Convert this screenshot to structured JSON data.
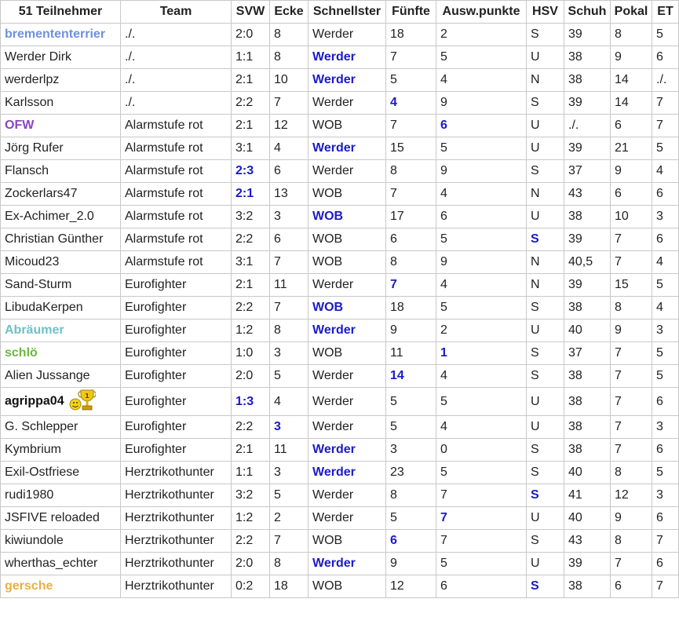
{
  "header": {
    "cells": [
      "51 Teilnehmer",
      "Team",
      "SVW",
      "Ecke",
      "Schnellster",
      "Fünfte",
      "Ausw.punkte",
      "HSV",
      "Schuh",
      "Pokal",
      "ET"
    ]
  },
  "rows": [
    {
      "c": [
        "bremententerrier",
        "./.",
        "2:0",
        "8",
        "Werder",
        "18",
        "2",
        "S",
        "39",
        "8",
        "5"
      ],
      "name_color": "#6f8fdf",
      "hl": []
    },
    {
      "c": [
        "Werder Dirk",
        "./.",
        "1:1",
        "8",
        "Werder",
        "7",
        "5",
        "U",
        "38",
        "9",
        "6"
      ],
      "name_color": "",
      "hl": [
        4
      ]
    },
    {
      "c": [
        "werderlpz",
        "./.",
        "2:1",
        "10",
        "Werder",
        "5",
        "4",
        "N",
        "38",
        "14",
        "./."
      ],
      "name_color": "",
      "hl": [
        4
      ]
    },
    {
      "c": [
        "Karlsson",
        "./.",
        "2:2",
        "7",
        "Werder",
        "4",
        "9",
        "S",
        "39",
        "14",
        "7"
      ],
      "name_color": "",
      "hl": [
        5
      ]
    },
    {
      "c": [
        "OFW",
        "Alarmstufe rot",
        "2:1",
        "12",
        "WOB",
        "7",
        "6",
        "U",
        "./.",
        "6",
        "7"
      ],
      "name_color": "#8a44c4",
      "hl": [
        6
      ]
    },
    {
      "c": [
        "Jörg Rufer",
        "Alarmstufe rot",
        "3:1",
        "4",
        "Werder",
        "15",
        "5",
        "U",
        "39",
        "21",
        "5"
      ],
      "name_color": "",
      "hl": [
        4
      ]
    },
    {
      "c": [
        "Flansch",
        "Alarmstufe rot",
        "2:3",
        "6",
        "Werder",
        "8",
        "9",
        "S",
        "37",
        "9",
        "4"
      ],
      "name_color": "",
      "hl": [
        2
      ]
    },
    {
      "c": [
        "Zockerlars47",
        "Alarmstufe rot",
        "2:1",
        "13",
        "WOB",
        "7",
        "4",
        "N",
        "43",
        "6",
        "6"
      ],
      "name_color": "",
      "hl": [
        2
      ]
    },
    {
      "c": [
        "Ex-Achimer_2.0",
        "Alarmstufe rot",
        "3:2",
        "3",
        "WOB",
        "17",
        "6",
        "U",
        "38",
        "10",
        "3"
      ],
      "name_color": "",
      "hl": [
        4
      ]
    },
    {
      "c": [
        "Christian Günther",
        "Alarmstufe rot",
        "2:2",
        "6",
        "WOB",
        "6",
        "5",
        "S",
        "39",
        "7",
        "6"
      ],
      "name_color": "",
      "hl": [
        7
      ]
    },
    {
      "c": [
        "Micoud23",
        "Alarmstufe rot",
        "3:1",
        "7",
        "WOB",
        "8",
        "9",
        "N",
        "40,5",
        "7",
        "4"
      ],
      "name_color": "",
      "hl": []
    },
    {
      "c": [
        "Sand-Sturm",
        "Eurofighter",
        "2:1",
        "11",
        "Werder",
        "7",
        "4",
        "N",
        "39",
        "15",
        "5"
      ],
      "name_color": "",
      "hl": [
        5
      ]
    },
    {
      "c": [
        "LibudaKerpen",
        "Eurofighter",
        "2:2",
        "7",
        "WOB",
        "18",
        "5",
        "S",
        "38",
        "8",
        "4"
      ],
      "name_color": "",
      "hl": [
        4
      ]
    },
    {
      "c": [
        "Abräumer",
        "Eurofighter",
        "1:2",
        "8",
        "Werder",
        "9",
        "2",
        "U",
        "40",
        "9",
        "3"
      ],
      "name_color": "#6fc0c8",
      "hl": [
        4
      ]
    },
    {
      "c": [
        "schlö",
        "Eurofighter",
        "1:0",
        "3",
        "WOB",
        "11",
        "1",
        "S",
        "37",
        "7",
        "5"
      ],
      "name_color": "#6ab83a",
      "hl": [
        6
      ]
    },
    {
      "c": [
        "Alien Jussange",
        "Eurofighter",
        "2:0",
        "5",
        "Werder",
        "14",
        "4",
        "S",
        "38",
        "7",
        "5"
      ],
      "name_color": "",
      "hl": [
        5
      ]
    },
    {
      "c": [
        "agrippa04",
        "Eurofighter",
        "1:3",
        "4",
        "Werder",
        "5",
        "5",
        "U",
        "38",
        "7",
        "6"
      ],
      "name_color": "#111111",
      "hl": [
        2
      ],
      "trophy": true
    },
    {
      "c": [
        "G. Schlepper",
        "Eurofighter",
        "2:2",
        "3",
        "Werder",
        "5",
        "4",
        "U",
        "38",
        "7",
        "3"
      ],
      "name_color": "",
      "hl": [
        3
      ]
    },
    {
      "c": [
        "Kymbrium",
        "Eurofighter",
        "2:1",
        "11",
        "Werder",
        "3",
        "0",
        "S",
        "38",
        "7",
        "6"
      ],
      "name_color": "",
      "hl": [
        4
      ]
    },
    {
      "c": [
        "Exil-Ostfriese",
        "Herztrikothunter",
        "1:1",
        "3",
        "Werder",
        "23",
        "5",
        "S",
        "40",
        "8",
        "5"
      ],
      "name_color": "",
      "hl": [
        4
      ]
    },
    {
      "c": [
        "rudi1980",
        "Herztrikothunter",
        "3:2",
        "5",
        "Werder",
        "8",
        "7",
        "S",
        "41",
        "12",
        "3"
      ],
      "name_color": "",
      "hl": [
        7
      ]
    },
    {
      "c": [
        "JSFIVE reloaded",
        "Herztrikothunter",
        "1:2",
        "2",
        "Werder",
        "5",
        "7",
        "U",
        "40",
        "9",
        "6"
      ],
      "name_color": "",
      "hl": [
        6
      ]
    },
    {
      "c": [
        "kiwiundole",
        "Herztrikothunter",
        "2:2",
        "7",
        "WOB",
        "6",
        "7",
        "S",
        "43",
        "8",
        "7"
      ],
      "name_color": "",
      "hl": [
        5
      ]
    },
    {
      "c": [
        "wherthas_echter",
        "Herztrikothunter",
        "2:0",
        "8",
        "Werder",
        "9",
        "5",
        "U",
        "39",
        "7",
        "6"
      ],
      "name_color": "",
      "hl": [
        4
      ]
    },
    {
      "c": [
        "gersche",
        "Herztrikothunter",
        "0:2",
        "18",
        "WOB",
        "12",
        "6",
        "S",
        "38",
        "6",
        "7"
      ],
      "name_color": "#e8b040",
      "hl": [
        7
      ]
    }
  ],
  "colors": {
    "highlight": "#1a1ac8",
    "border": "#c8c8c8",
    "text": "#222222"
  },
  "icons": {
    "trophy": "trophy-smiley-icon"
  }
}
